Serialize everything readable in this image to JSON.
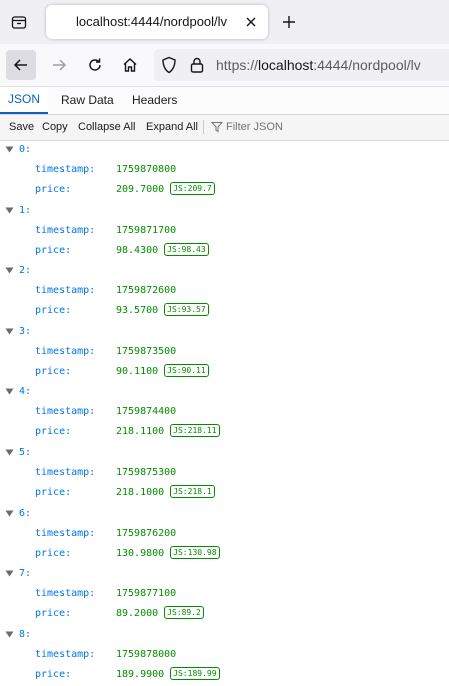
{
  "browser": {
    "tab_title": "localhost:4444/nordpool/lv",
    "url_scheme": "https://",
    "url_host": "localhost",
    "url_rest": ":4444/nordpool/lv"
  },
  "viewer": {
    "tabs": [
      "JSON",
      "Raw Data",
      "Headers"
    ],
    "toolbar": {
      "save": "Save",
      "copy": "Copy",
      "collapse_all": "Collapse All",
      "expand_all": "Expand All",
      "filter_placeholder": "Filter JSON"
    }
  },
  "json": {
    "timestamp_key": "timestamp:",
    "price_key": "price:",
    "badge_prefix": "JS:",
    "entries": [
      {
        "index": "0:",
        "timestamp": "1759870800",
        "price": "209.7000",
        "js": "209.7"
      },
      {
        "index": "1:",
        "timestamp": "1759871700",
        "price": "98.4300",
        "js": "98.43"
      },
      {
        "index": "2:",
        "timestamp": "1759872600",
        "price": "93.5700",
        "js": "93.57"
      },
      {
        "index": "3:",
        "timestamp": "1759873500",
        "price": "90.1100",
        "js": "90.11"
      },
      {
        "index": "4:",
        "timestamp": "1759874400",
        "price": "218.1100",
        "js": "218.11"
      },
      {
        "index": "5:",
        "timestamp": "1759875300",
        "price": "218.1000",
        "js": "218.1"
      },
      {
        "index": "6:",
        "timestamp": "1759876200",
        "price": "130.9800",
        "js": "130.98"
      },
      {
        "index": "7:",
        "timestamp": "1759877100",
        "price": "89.2000",
        "js": "89.2"
      },
      {
        "index": "8:",
        "timestamp": "1759878000",
        "price": "189.9900",
        "js": "189.99"
      }
    ]
  },
  "colors": {
    "key": "#0074e8",
    "value": "#058b00",
    "accent": "#0a5fc2"
  }
}
